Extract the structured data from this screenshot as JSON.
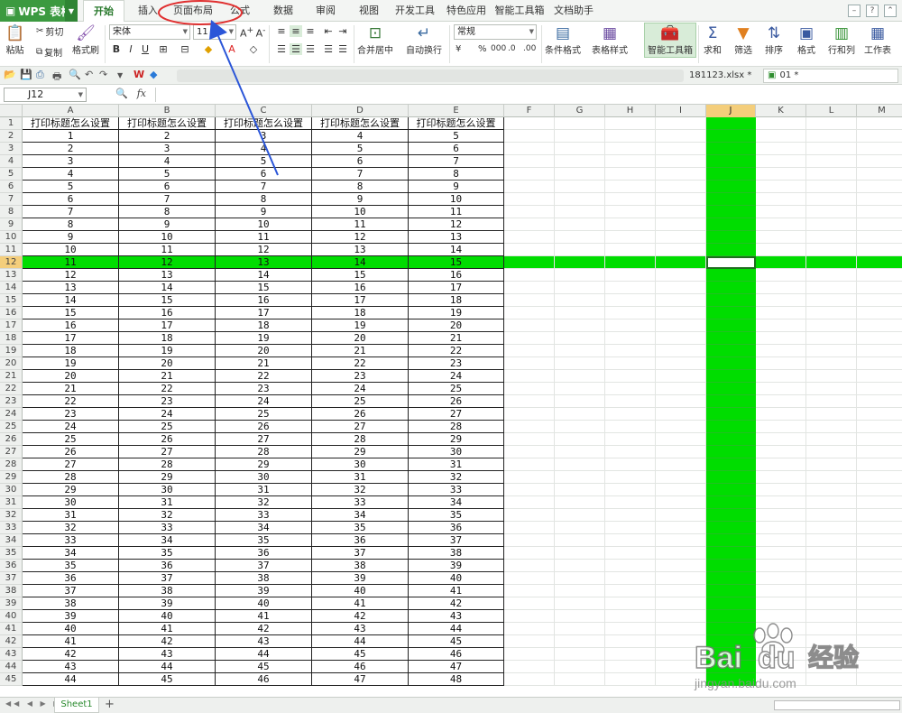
{
  "app": {
    "name": "WPS 表格"
  },
  "tabs": [
    {
      "label": "开始",
      "active": true
    },
    {
      "label": "插入"
    },
    {
      "label": "页面布局"
    },
    {
      "label": "公式"
    },
    {
      "label": "数据"
    },
    {
      "label": "审阅"
    },
    {
      "label": "视图"
    },
    {
      "label": "开发工具"
    },
    {
      "label": "特色应用"
    },
    {
      "label": "智能工具箱"
    },
    {
      "label": "文档助手"
    }
  ],
  "ribbon": {
    "paste": "粘贴",
    "cut": "剪切",
    "copy": "复制",
    "format_painter": "格式刷",
    "font": "宋体",
    "font_size": "11",
    "bold": "B",
    "italic": "I",
    "underline": "U",
    "merge_center": "合并居中",
    "wrap_text": "自动换行",
    "number_format": "常规",
    "percent": "%",
    "comma": "000",
    "cond_format": "条件格式",
    "table_style": "表格样式",
    "smart_toolbox": "智能工具箱",
    "sum": "求和",
    "filter": "筛选",
    "sort": "排序",
    "format": "格式",
    "rowcol": "行和列",
    "worksheet": "工作表"
  },
  "doc_tabs": {
    "file1": "181123.xlsx *",
    "file2": "01 *"
  },
  "formula_bar": {
    "cell_ref": "J12",
    "value": ""
  },
  "columns": [
    "A",
    "B",
    "C",
    "D",
    "E",
    "F",
    "G",
    "H",
    "I",
    "J",
    "K",
    "L",
    "M"
  ],
  "selected_col": "J",
  "selected_row": 12,
  "header_text": "打印标题怎么设置",
  "row_count": 45,
  "sheet": {
    "name": "Sheet1",
    "add": "+"
  },
  "watermark": {
    "brand": "Bai",
    "brand2": "du",
    "cn": "经验",
    "url": "jingyan.baidu.com"
  },
  "colors": {
    "highlight": "#00dd00",
    "wps_green": "#3c9a40",
    "annotation": "#e03030",
    "arrow": "#2b56d8"
  }
}
